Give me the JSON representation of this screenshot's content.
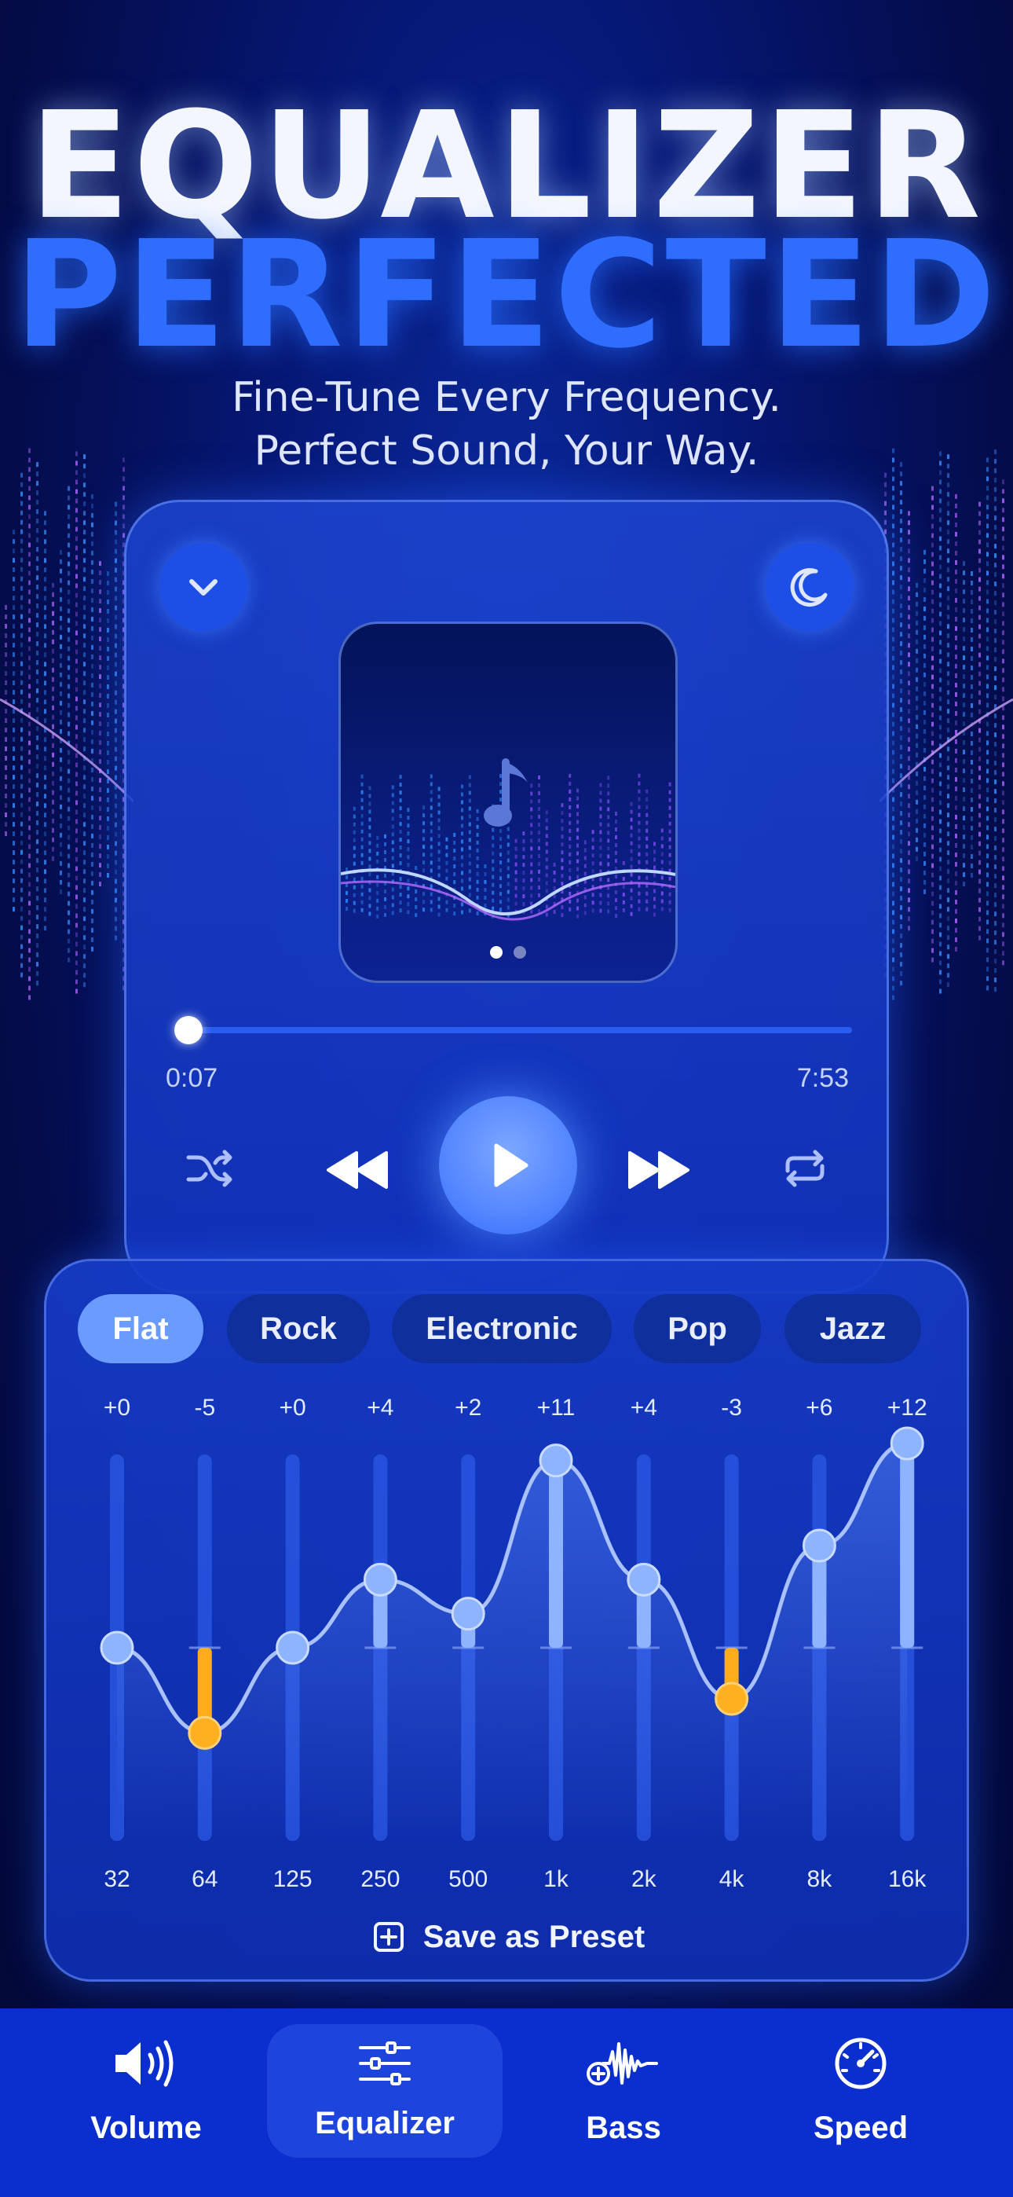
{
  "hero": {
    "title_line1": "EQUALIZER",
    "title_line2": "PERFECTED",
    "subtitle_line1": "Fine-Tune Every Frequency.",
    "subtitle_line2": "Perfect Sound, Your Way."
  },
  "player": {
    "collapse_icon": "chevron-down-icon",
    "sleep_icon": "moon-icon",
    "album_icon": "music-note-icon",
    "page_dots": {
      "count": 2,
      "active": 0
    },
    "elapsed": "0:07",
    "duration": "7:53",
    "progress_fraction": 0.015,
    "controls": [
      "shuffle-icon",
      "rewind-icon",
      "play-icon",
      "fast-forward-icon",
      "repeat-icon"
    ]
  },
  "equalizer": {
    "presets": [
      {
        "label": "Flat",
        "active": true
      },
      {
        "label": "Rock",
        "active": false
      },
      {
        "label": "Electronic",
        "active": false
      },
      {
        "label": "Pop",
        "active": false
      },
      {
        "label": "Jazz",
        "active": false
      }
    ],
    "bands": [
      {
        "freq": "32",
        "gain_label": "+0",
        "gain": 0
      },
      {
        "freq": "64",
        "gain_label": "-5",
        "gain": -5
      },
      {
        "freq": "125",
        "gain_label": "+0",
        "gain": 0
      },
      {
        "freq": "250",
        "gain_label": "+4",
        "gain": 4
      },
      {
        "freq": "500",
        "gain_label": "+2",
        "gain": 2
      },
      {
        "freq": "1k",
        "gain_label": "+11",
        "gain": 11
      },
      {
        "freq": "2k",
        "gain_label": "+4",
        "gain": 4
      },
      {
        "freq": "4k",
        "gain_label": "-3",
        "gain": -3
      },
      {
        "freq": "8k",
        "gain_label": "+6",
        "gain": 6
      },
      {
        "freq": "16k",
        "gain_label": "+12",
        "gain": 12
      }
    ],
    "gain_range": [
      -12,
      12
    ],
    "save_label": "Save as Preset",
    "save_icon": "plus-square-icon"
  },
  "tabbar": {
    "tabs": [
      {
        "label": "Volume",
        "icon": "speaker-icon",
        "active": false
      },
      {
        "label": "Equalizer",
        "icon": "sliders-icon",
        "active": true
      },
      {
        "label": "Bass",
        "icon": "bass-wave-icon",
        "active": false
      },
      {
        "label": "Speed",
        "icon": "speedometer-icon",
        "active": false
      }
    ]
  },
  "colors": {
    "accent": "#2f6dff",
    "positive_band": "#8fb4ff",
    "negative_band": "#ffae1a",
    "tabbar_bg": "#0b2fcf"
  }
}
